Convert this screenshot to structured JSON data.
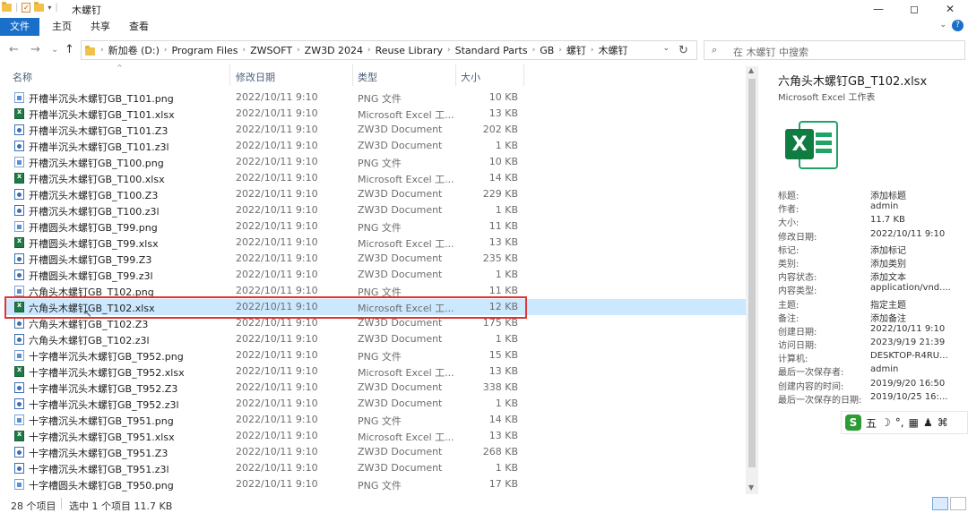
{
  "window": {
    "title": "木螺钉",
    "controls": {
      "minimize": "—",
      "maximize": "◻",
      "close": "✕"
    }
  },
  "ribbon": {
    "tabs": [
      "文件",
      "主页",
      "共享",
      "查看"
    ]
  },
  "nav": {
    "back": "←",
    "forward": "→",
    "recent": "⌄",
    "up": "↑"
  },
  "address": {
    "crumbs": [
      "新加卷 (D:)",
      "Program Files",
      "ZWSOFT",
      "ZW3D 2024",
      "Reuse Library",
      "Standard Parts",
      "GB",
      "螺钉",
      "木螺钉"
    ]
  },
  "search": {
    "placeholder": "在 木螺钉 中搜索"
  },
  "columns": {
    "name": "名称",
    "date": "修改日期",
    "type": "类型",
    "size": "大小"
  },
  "files": [
    {
      "name": "开槽半沉头木螺钉GB_T101.png",
      "date": "2022/10/11 9:10",
      "type": "PNG 文件",
      "size": "10 KB",
      "icon": "png"
    },
    {
      "name": "开槽半沉头木螺钉GB_T101.xlsx",
      "date": "2022/10/11 9:10",
      "type": "Microsoft Excel 工...",
      "size": "13 KB",
      "icon": "xlsx"
    },
    {
      "name": "开槽半沉头木螺钉GB_T101.Z3",
      "date": "2022/10/11 9:10",
      "type": "ZW3D Document",
      "size": "202 KB",
      "icon": "z3"
    },
    {
      "name": "开槽半沉头木螺钉GB_T101.z3l",
      "date": "2022/10/11 9:10",
      "type": "ZW3D Document",
      "size": "1 KB",
      "icon": "z3"
    },
    {
      "name": "开槽沉头木螺钉GB_T100.png",
      "date": "2022/10/11 9:10",
      "type": "PNG 文件",
      "size": "10 KB",
      "icon": "png"
    },
    {
      "name": "开槽沉头木螺钉GB_T100.xlsx",
      "date": "2022/10/11 9:10",
      "type": "Microsoft Excel 工...",
      "size": "14 KB",
      "icon": "xlsx"
    },
    {
      "name": "开槽沉头木螺钉GB_T100.Z3",
      "date": "2022/10/11 9:10",
      "type": "ZW3D Document",
      "size": "229 KB",
      "icon": "z3"
    },
    {
      "name": "开槽沉头木螺钉GB_T100.z3l",
      "date": "2022/10/11 9:10",
      "type": "ZW3D Document",
      "size": "1 KB",
      "icon": "z3"
    },
    {
      "name": "开槽圆头木螺钉GB_T99.png",
      "date": "2022/10/11 9:10",
      "type": "PNG 文件",
      "size": "11 KB",
      "icon": "png"
    },
    {
      "name": "开槽圆头木螺钉GB_T99.xlsx",
      "date": "2022/10/11 9:10",
      "type": "Microsoft Excel 工...",
      "size": "13 KB",
      "icon": "xlsx"
    },
    {
      "name": "开槽圆头木螺钉GB_T99.Z3",
      "date": "2022/10/11 9:10",
      "type": "ZW3D Document",
      "size": "235 KB",
      "icon": "z3"
    },
    {
      "name": "开槽圆头木螺钉GB_T99.z3l",
      "date": "2022/10/11 9:10",
      "type": "ZW3D Document",
      "size": "1 KB",
      "icon": "z3"
    },
    {
      "name": "六角头木螺钉GB_T102.png",
      "date": "2022/10/11 9:10",
      "type": "PNG 文件",
      "size": "11 KB",
      "icon": "png"
    },
    {
      "name": "六角头木螺钉GB_T102.xlsx",
      "date": "2022/10/11 9:10",
      "type": "Microsoft Excel 工...",
      "size": "12 KB",
      "icon": "xlsx",
      "selected": true
    },
    {
      "name": "六角头木螺钉GB_T102.Z3",
      "date": "2022/10/11 9:10",
      "type": "ZW3D Document",
      "size": "175 KB",
      "icon": "z3"
    },
    {
      "name": "六角头木螺钉GB_T102.z3l",
      "date": "2022/10/11 9:10",
      "type": "ZW3D Document",
      "size": "1 KB",
      "icon": "z3"
    },
    {
      "name": "十字槽半沉头木螺钉GB_T952.png",
      "date": "2022/10/11 9:10",
      "type": "PNG 文件",
      "size": "15 KB",
      "icon": "png"
    },
    {
      "name": "十字槽半沉头木螺钉GB_T952.xlsx",
      "date": "2022/10/11 9:10",
      "type": "Microsoft Excel 工...",
      "size": "13 KB",
      "icon": "xlsx"
    },
    {
      "name": "十字槽半沉头木螺钉GB_T952.Z3",
      "date": "2022/10/11 9:10",
      "type": "ZW3D Document",
      "size": "338 KB",
      "icon": "z3"
    },
    {
      "name": "十字槽半沉头木螺钉GB_T952.z3l",
      "date": "2022/10/11 9:10",
      "type": "ZW3D Document",
      "size": "1 KB",
      "icon": "z3"
    },
    {
      "name": "十字槽沉头木螺钉GB_T951.png",
      "date": "2022/10/11 9:10",
      "type": "PNG 文件",
      "size": "14 KB",
      "icon": "png"
    },
    {
      "name": "十字槽沉头木螺钉GB_T951.xlsx",
      "date": "2022/10/11 9:10",
      "type": "Microsoft Excel 工...",
      "size": "13 KB",
      "icon": "xlsx"
    },
    {
      "name": "十字槽沉头木螺钉GB_T951.Z3",
      "date": "2022/10/11 9:10",
      "type": "ZW3D Document",
      "size": "268 KB",
      "icon": "z3"
    },
    {
      "name": "十字槽沉头木螺钉GB_T951.z3l",
      "date": "2022/10/11 9:10",
      "type": "ZW3D Document",
      "size": "1 KB",
      "icon": "z3"
    },
    {
      "name": "十字槽圆头木螺钉GB_T950.png",
      "date": "2022/10/11 9:10",
      "type": "PNG 文件",
      "size": "17 KB",
      "icon": "png"
    }
  ],
  "preview": {
    "title": "六角头木螺钉GB_T102.xlsx",
    "subtitle": "Microsoft Excel 工作表",
    "icon_letter": "X",
    "properties": [
      {
        "key": "标题:",
        "value": "添加标题"
      },
      {
        "key": "作者:",
        "value": "admin"
      },
      {
        "key": "大小:",
        "value": "11.7 KB"
      },
      {
        "key": "修改日期:",
        "value": "2022/10/11 9:10"
      },
      {
        "key": "标记:",
        "value": "添加标记"
      },
      {
        "key": "类别:",
        "value": "添加类别"
      },
      {
        "key": "内容状态:",
        "value": "添加文本"
      },
      {
        "key": "内容类型:",
        "value": "application/vnd...."
      },
      {
        "key": "主题:",
        "value": "指定主题"
      },
      {
        "key": "备注:",
        "value": "添加备注"
      },
      {
        "key": "创建日期:",
        "value": "2022/10/11 9:10"
      },
      {
        "key": "访问日期:",
        "value": "2023/9/19 21:39"
      },
      {
        "key": "计算机:",
        "value": "DESKTOP-R4RU..."
      },
      {
        "key": "最后一次保存者:",
        "value": "admin"
      },
      {
        "key": "创建内容的时间:",
        "value": "2019/9/20 16:50"
      },
      {
        "key": "最后一次保存的日期:",
        "value": "2019/10/25 16:..."
      }
    ]
  },
  "ime": {
    "logo": "S",
    "mode": "五",
    "icons": [
      "☽",
      "°,",
      "▦",
      "♟",
      "⌘"
    ]
  },
  "status": {
    "count": "28 个项目",
    "selection": "选中 1 个项目  11.7 KB"
  },
  "colors": {
    "accent": "#1a6fc9",
    "selection": "#cce8ff",
    "highlight_box": "#e03535",
    "excel_green": "#1f7a45"
  }
}
